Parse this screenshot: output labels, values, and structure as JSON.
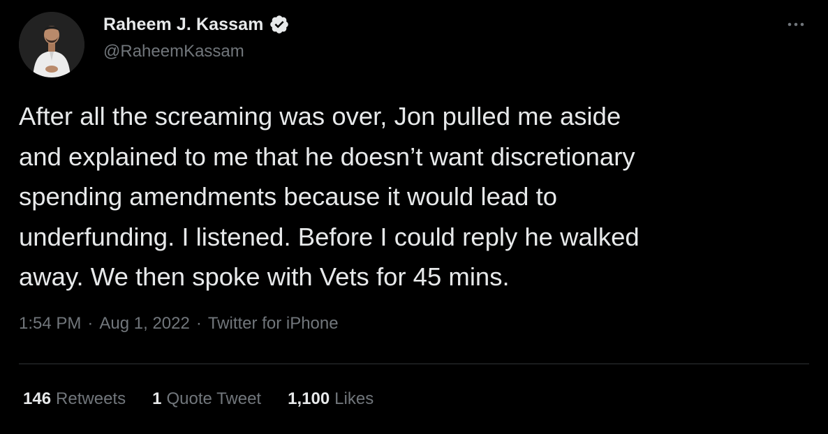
{
  "author": {
    "display_name": "Raheem J. Kassam",
    "handle": "@RaheemKassam",
    "verified": true,
    "avatar_icon": "avatar-photo"
  },
  "menu_icon": "more-horizontal-icon",
  "tweet": {
    "text": "After all the screaming was over, Jon pulled me aside\nand explained to me that he doesn’t want discretionary\nspending amendments because it would lead to\nunderfunding. I listened. Before I could reply he walked\naway. We then spoke with Vets for 45 mins."
  },
  "meta": {
    "time": "1:54 PM",
    "separator": "·",
    "date": "Aug 1, 2022",
    "source": "Twitter for iPhone"
  },
  "stats": {
    "retweets": {
      "count": "146",
      "label": "Retweets"
    },
    "quotes": {
      "count": "1",
      "label": "Quote Tweet"
    },
    "likes": {
      "count": "1,100",
      "label": "Likes"
    }
  },
  "colors": {
    "background": "#000000",
    "primary_text": "#e7e9ea",
    "secondary_text": "#71767b",
    "divider": "#2f3336",
    "verified_badge": "#e7e9ea"
  }
}
